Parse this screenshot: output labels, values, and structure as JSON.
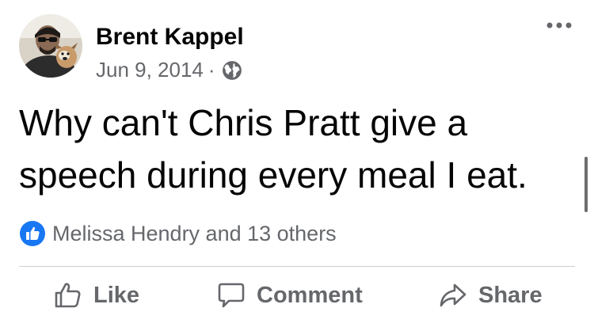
{
  "post": {
    "author": "Brent Kappel",
    "date": "Jun 9, 2014",
    "separator": "·",
    "audience_icon": "globe-icon",
    "more_icon": "more-options-icon",
    "message": "Why can't Chris Pratt give a speech during every meal I eat."
  },
  "reactions": {
    "icon": "like-reaction-icon",
    "summary": "Melissa Hendry and 13 others"
  },
  "actions": {
    "like_label": "Like",
    "comment_label": "Comment",
    "share_label": "Share"
  },
  "colors": {
    "text_primary": "#050505",
    "text_secondary": "#65676b",
    "brand_blue": "#1877f2",
    "divider": "#ced0d4"
  }
}
